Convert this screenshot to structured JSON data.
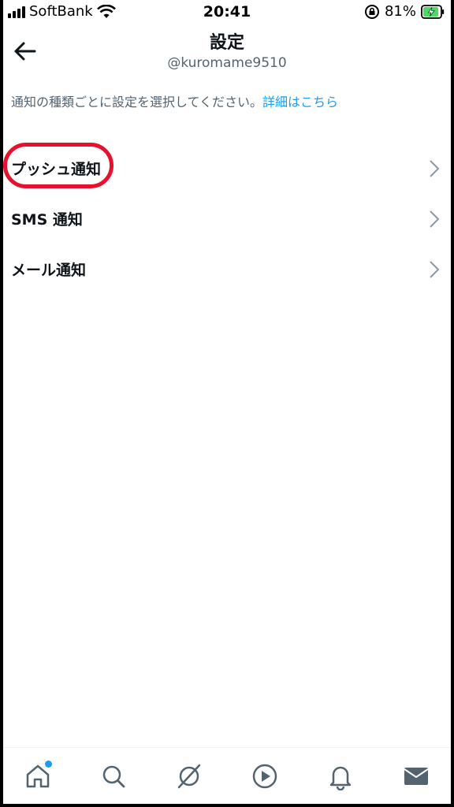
{
  "status_bar": {
    "carrier": "SoftBank",
    "time": "20:41",
    "battery": "81%"
  },
  "header": {
    "title": "設定",
    "username": "@kuromame9510"
  },
  "description": {
    "text": "通知の種類ごとに設定を選択してください。",
    "link": "詳細はこちら"
  },
  "menu": [
    {
      "label": "プッシュ通知"
    },
    {
      "label": "SMS 通知"
    },
    {
      "label": "メール通知"
    }
  ],
  "colors": {
    "accent": "#1d9bf0",
    "highlight": "#e8112d",
    "text": "#0f1419",
    "secondary": "#536471"
  },
  "tabs": [
    "home-icon",
    "search-icon",
    "spaces-icon",
    "video-icon",
    "notifications-icon",
    "messages-icon"
  ]
}
